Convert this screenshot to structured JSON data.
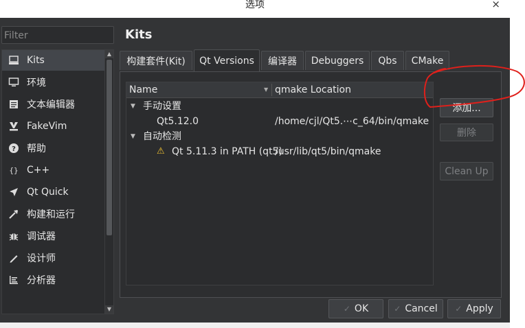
{
  "window": {
    "title": "选项",
    "close_glyph": "×"
  },
  "filter": {
    "placeholder": "Filter"
  },
  "sidebar": {
    "items": [
      {
        "label": "Kits",
        "icon": "kits-icon",
        "selected": true
      },
      {
        "label": "环境",
        "icon": "monitor-icon"
      },
      {
        "label": "文本编辑器",
        "icon": "text-editor-icon"
      },
      {
        "label": "FakeVim",
        "icon": "fakevim-icon"
      },
      {
        "label": "帮助",
        "icon": "help-icon"
      },
      {
        "label": "C++",
        "icon": "braces-icon"
      },
      {
        "label": "Qt Quick",
        "icon": "qt-quick-icon"
      },
      {
        "label": "构建和运行",
        "icon": "hammer-icon"
      },
      {
        "label": "调试器",
        "icon": "bug-icon"
      },
      {
        "label": "设计师",
        "icon": "pen-icon"
      },
      {
        "label": "分析器",
        "icon": "analyzer-icon"
      }
    ]
  },
  "page": {
    "title": "Kits"
  },
  "tabs": [
    {
      "label": "构建套件(Kit)"
    },
    {
      "label": "Qt Versions",
      "active": true
    },
    {
      "label": "编译器"
    },
    {
      "label": "Debuggers"
    },
    {
      "label": "Qbs"
    },
    {
      "label": "CMake"
    }
  ],
  "table": {
    "columns": [
      "Name",
      "qmake Location"
    ],
    "groups": [
      {
        "label": "手动设置",
        "rows": [
          {
            "name": "Qt5.12.0",
            "location": "/home/cjl/Qt5.⋯c_64/bin/qmake",
            "warning": false
          }
        ]
      },
      {
        "label": "自动检测",
        "rows": [
          {
            "name": "Qt 5.11.3 in PATH (qt5)",
            "location": "/usr/lib/qt5/bin/qmake",
            "warning": true
          }
        ]
      }
    ]
  },
  "side_buttons": {
    "add": "添加...",
    "remove": "删除",
    "cleanup": "Clean Up"
  },
  "footer": {
    "ok": "OK",
    "cancel": "Cancel",
    "apply": "Apply"
  },
  "colors": {
    "annotation": "#e0201b",
    "warning": "#f2c230",
    "background": "#333436"
  }
}
